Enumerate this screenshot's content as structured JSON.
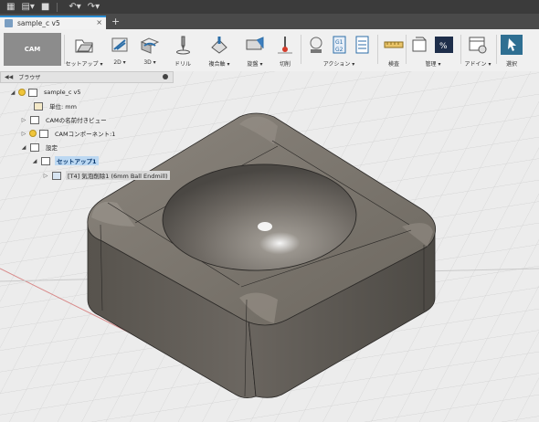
{
  "document": {
    "tab_title": "sample_c v5",
    "new_tab": "+",
    "close": "×"
  },
  "ribbon": {
    "workspace": "CAM",
    "groups": [
      {
        "name": "setup",
        "label": "セットアップ ▾"
      },
      {
        "name": "2d",
        "label": "2D ▾"
      },
      {
        "name": "3d",
        "label": "3D ▾"
      },
      {
        "name": "drill",
        "label": "ドリル"
      },
      {
        "name": "multiaxis",
        "label": "複合軸 ▾"
      },
      {
        "name": "turning",
        "label": "旋盤 ▾"
      },
      {
        "name": "cutting",
        "label": "切削"
      },
      {
        "name": "actions",
        "label": "アクション ▾"
      },
      {
        "name": "inspect",
        "label": "検査"
      },
      {
        "name": "manage",
        "label": "管理 ▾"
      },
      {
        "name": "addins",
        "label": "アドイン ▾"
      },
      {
        "name": "select",
        "label": "選択"
      }
    ]
  },
  "browser": {
    "title": "ブラウザ",
    "items": [
      {
        "label": "sample_c v5"
      },
      {
        "label": "単位: mm"
      },
      {
        "label": "CAMの名前付きビュー"
      },
      {
        "label": "CAMコンポーネント:1"
      },
      {
        "label": "設定"
      },
      {
        "label": "セットアップ1"
      },
      {
        "label": "[T4] 気泡削除1 (6mm Ball Endmill)"
      }
    ]
  },
  "colors": {
    "accent": "#2c8fd6",
    "model": "#6d675f",
    "ribbon": "#f0f0f0",
    "topbar": "#3b3b3b"
  }
}
